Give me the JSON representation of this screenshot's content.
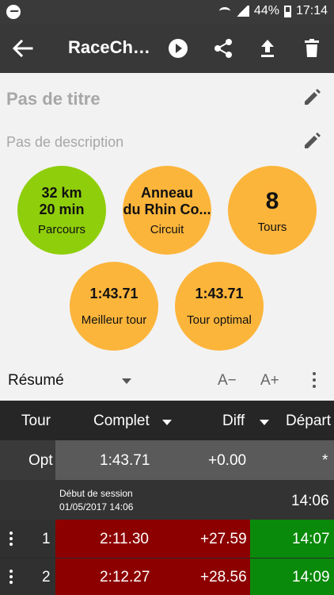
{
  "status_bar": {
    "battery": "44%",
    "time": "17:14"
  },
  "app_bar": {
    "title": "RaceChrono"
  },
  "session": {
    "title_placeholder": "Pas de titre",
    "description_placeholder": "Pas de description"
  },
  "circles": {
    "parcours": {
      "line1": "32 km",
      "line2": "20 min",
      "label": "Parcours"
    },
    "circuit": {
      "line1": "Anneau",
      "line2": "du Rhin Co...",
      "label": "Circuit"
    },
    "tours": {
      "value": "8",
      "label": "Tours"
    },
    "best": {
      "value": "1:43.71",
      "label": "Meilleur tour"
    },
    "optimal": {
      "value": "1:43.71",
      "label": "Tour optimal"
    }
  },
  "summary": {
    "label": "Résumé",
    "decrease": "A−",
    "increase": "A+"
  },
  "table": {
    "headers": {
      "lap": "Tour",
      "full": "Complet",
      "diff": "Diff",
      "start": "Départ"
    },
    "opt_row": {
      "lap": "Opt",
      "full": "1:43.71",
      "diff": "+0.00",
      "start": "*"
    },
    "session_row": {
      "label": "Début de session",
      "date": "01/05/2017 14:06",
      "start": "14:06"
    },
    "laps": [
      {
        "lap": "1",
        "full": "2:11.30",
        "diff": "+27.59",
        "start": "14:07"
      },
      {
        "lap": "2",
        "full": "2:12.27",
        "diff": "+28.56",
        "start": "14:09"
      }
    ]
  },
  "colors": {
    "green": "#8fce0b",
    "orange": "#fcb53b",
    "red": "#8c0000",
    "lap_green": "#0a8a0a"
  }
}
